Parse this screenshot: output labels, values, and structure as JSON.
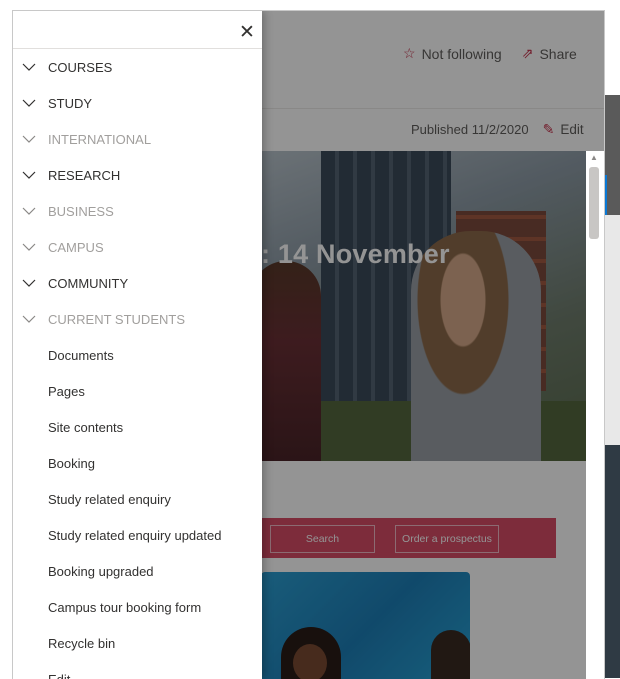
{
  "header": {
    "follow_label": "Not following",
    "share_label": "Share",
    "published_label": "Published 11/2/2020",
    "edit_label": "Edit"
  },
  "hero": {
    "title": ": 14 November"
  },
  "cta": {
    "search_label": "Search",
    "prospectus_label": "Order a prospectus"
  },
  "nav": {
    "close_icon": "close-icon",
    "sections": [
      {
        "label": "COURSES",
        "muted": false
      },
      {
        "label": "STUDY",
        "muted": false
      },
      {
        "label": "INTERNATIONAL",
        "muted": true
      },
      {
        "label": "RESEARCH",
        "muted": false
      },
      {
        "label": "BUSINESS",
        "muted": true
      },
      {
        "label": "CAMPUS",
        "muted": true
      },
      {
        "label": "COMMUNITY",
        "muted": false
      },
      {
        "label": "CURRENT STUDENTS",
        "muted": true
      }
    ],
    "links": [
      "Documents",
      "Pages",
      "Site contents",
      "Booking",
      "Study related enquiry",
      "Study related enquiry updated",
      "Booking upgraded",
      "Campus tour booking form",
      "Recycle bin",
      "Edit"
    ]
  },
  "colors": {
    "accent_pink": "#d84c67",
    "muted_text": "#a19f9d",
    "icon_red": "#c4314b"
  }
}
